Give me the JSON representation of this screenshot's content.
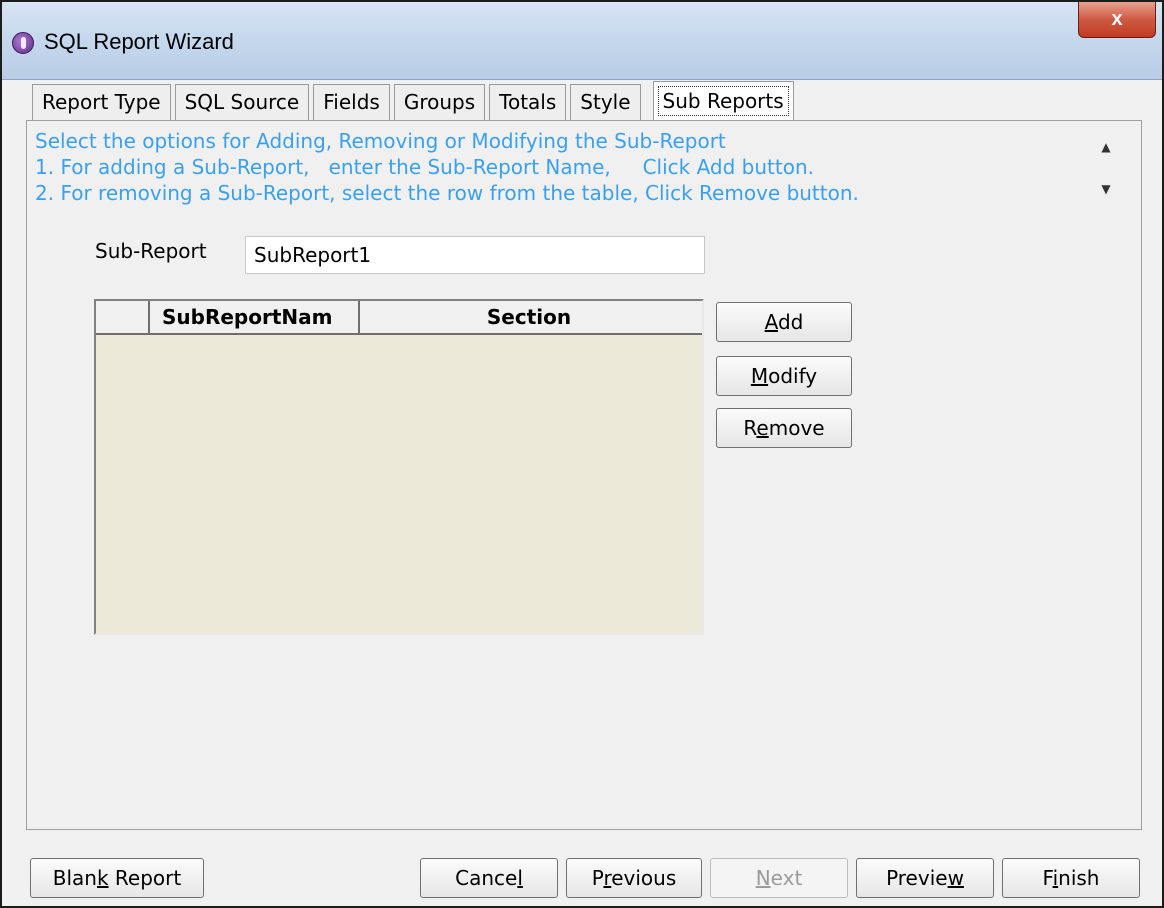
{
  "window": {
    "title": "SQL Report Wizard",
    "close_label": "x"
  },
  "tabs": [
    {
      "label": "Report Type",
      "active": false
    },
    {
      "label": "SQL Source",
      "active": false
    },
    {
      "label": "Fields",
      "active": false
    },
    {
      "label": "Groups",
      "active": false
    },
    {
      "label": "Totals",
      "active": false
    },
    {
      "label": "Style",
      "active": false
    },
    {
      "label": "Sub Reports",
      "active": true
    }
  ],
  "instructions": {
    "line1": "Select the options for Adding, Removing or Modifying the Sub-Report",
    "line2": "1. For adding a Sub-Report,   enter the Sub-Report Name,     Click Add button.",
    "line3": "2. For removing a Sub-Report, select the row from the table, Click Remove button.",
    "color": "#3aa0ee"
  },
  "subreport": {
    "label": "Sub-Report",
    "value": "SubReport1"
  },
  "table": {
    "columns": [
      "",
      "SubReportNam",
      "Section"
    ],
    "rows": [],
    "background": "#ece9d8"
  },
  "side_buttons": {
    "add": {
      "pre": "",
      "key": "A",
      "post": "dd"
    },
    "modify": {
      "pre": "",
      "key": "M",
      "post": "odify"
    },
    "remove": {
      "pre": "R",
      "key": "e",
      "post": "move"
    }
  },
  "footer_buttons": {
    "blank_report": {
      "pre": "Blan",
      "key": "k",
      "post": " Report"
    },
    "cancel": {
      "pre": "Cance",
      "key": "l",
      "post": ""
    },
    "previous": {
      "pre": "P",
      "key": "r",
      "post": "evious"
    },
    "next": {
      "pre": "",
      "key": "N",
      "post": "ext",
      "disabled": true
    },
    "preview": {
      "pre": "Previe",
      "key": "w",
      "post": ""
    },
    "finish": {
      "pre": "F",
      "key": "i",
      "post": "nish"
    }
  },
  "icons": {
    "app": "report-wizard-icon",
    "scroll_up": "scroll-up-arrow-icon",
    "scroll_down": "scroll-down-arrow-icon"
  }
}
